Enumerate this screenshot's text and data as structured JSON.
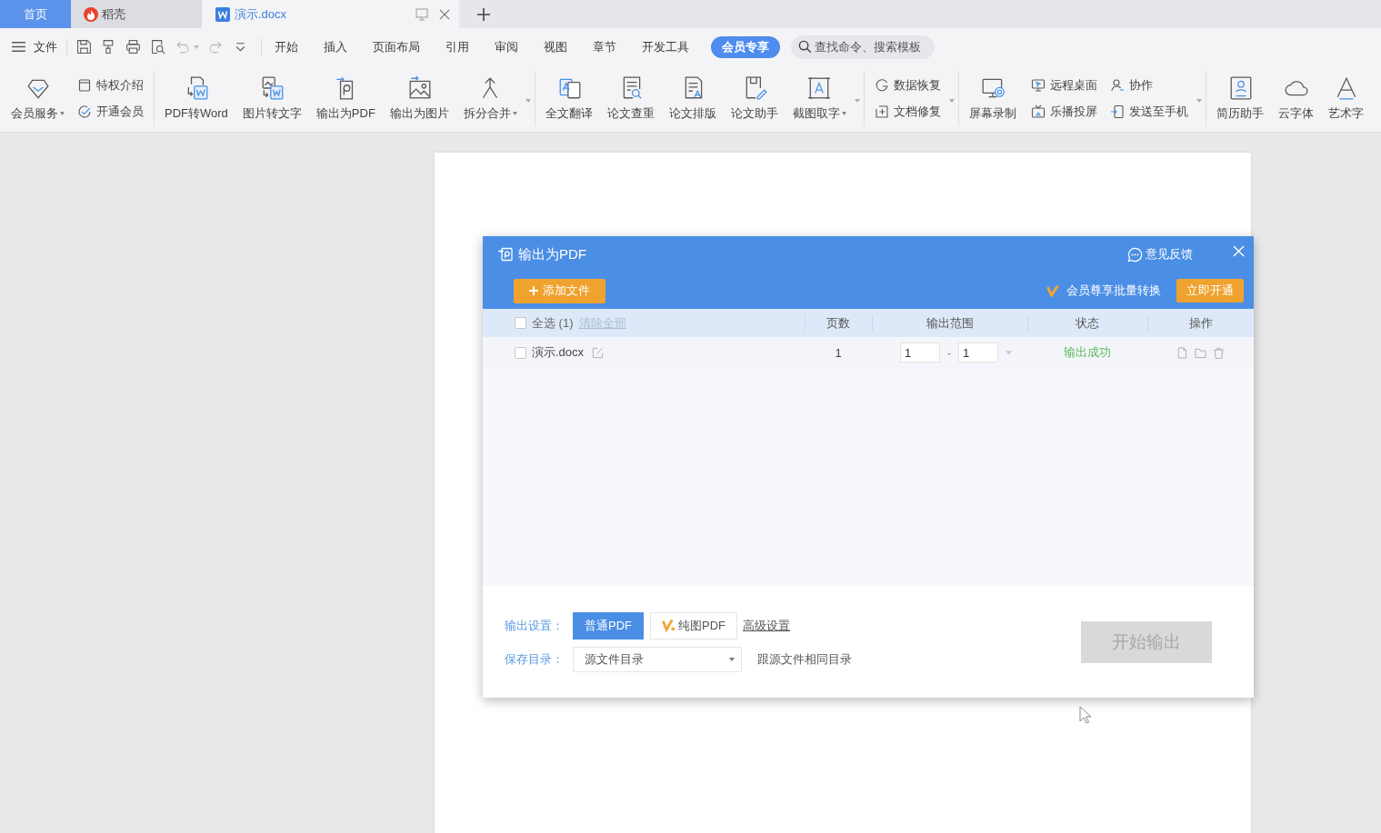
{
  "tabs": [
    {
      "kind": "home",
      "label": "首页",
      "selected": false
    },
    {
      "kind": "docer",
      "label": "稻壳",
      "selected": false
    },
    {
      "kind": "document",
      "label": "演示.docx",
      "selected": true
    }
  ],
  "menu": {
    "file": "文件",
    "items": [
      {
        "label": "开始",
        "selected": false
      },
      {
        "label": "插入",
        "selected": false
      },
      {
        "label": "页面布局",
        "selected": false
      },
      {
        "label": "引用",
        "selected": false
      },
      {
        "label": "审阅",
        "selected": false
      },
      {
        "label": "视图",
        "selected": false
      },
      {
        "label": "章节",
        "selected": false
      },
      {
        "label": "开发工具",
        "selected": false
      },
      {
        "label": "会员专享",
        "selected": true
      }
    ],
    "search": {
      "placeholder": "查找命令、搜索模板"
    }
  },
  "ribbon": {
    "groups": [
      {
        "items": [
          {
            "kind": "large",
            "label": "会员服务",
            "menu": true
          },
          {
            "kind": "column",
            "items": [
              {
                "label": "特权介绍"
              },
              {
                "label": "开通会员"
              }
            ]
          }
        ]
      },
      {
        "items": [
          {
            "kind": "large",
            "label": "PDF转Word",
            "menu": false
          },
          {
            "kind": "large",
            "label": "图片转文字",
            "menu": false
          },
          {
            "kind": "large",
            "label": "输出为PDF",
            "menu": false
          },
          {
            "kind": "large",
            "label": "输出为图片",
            "menu": false
          },
          {
            "kind": "large",
            "label": "拆分合并",
            "menu": true
          },
          {
            "kind": "more"
          }
        ]
      },
      {
        "items": [
          {
            "kind": "large",
            "label": "全文翻译",
            "menu": false
          },
          {
            "kind": "large",
            "label": "论文查重",
            "menu": false
          },
          {
            "kind": "large",
            "label": "论文排版",
            "menu": false
          },
          {
            "kind": "large",
            "label": "论文助手",
            "menu": false
          },
          {
            "kind": "large",
            "label": "截图取字",
            "menu": true
          },
          {
            "kind": "more"
          }
        ]
      },
      {
        "items": [
          {
            "kind": "column",
            "items": [
              {
                "label": "数据恢复"
              },
              {
                "label": "文档修复"
              }
            ]
          },
          {
            "kind": "more"
          }
        ]
      },
      {
        "items": [
          {
            "kind": "large",
            "label": "屏幕录制",
            "menu": false
          },
          {
            "kind": "column",
            "items": [
              {
                "label": "远程桌面"
              },
              {
                "label": "乐播投屏"
              }
            ]
          },
          {
            "kind": "column",
            "items": [
              {
                "label": "协作"
              },
              {
                "label": "发送至手机"
              }
            ]
          },
          {
            "kind": "more"
          }
        ]
      },
      {
        "items": [
          {
            "kind": "large",
            "label": "简历助手",
            "menu": false
          },
          {
            "kind": "large",
            "label": "云字体",
            "menu": false
          },
          {
            "kind": "large",
            "label": "艺术字",
            "menu": false
          }
        ]
      }
    ]
  },
  "dialog": {
    "title": "输出为PDF",
    "feedback": "意见反馈",
    "add_button": "添加文件",
    "promo": "会员尊享批量转换",
    "promo_button": "立即开通",
    "table": {
      "select_all": {
        "label": "全选 (1)",
        "checked": false
      },
      "clear": "清除全部",
      "columns": [
        "页数",
        "输出范围",
        "状态",
        "操作"
      ],
      "rows": [
        {
          "name": "演示.docx",
          "checked": false,
          "pages": "1",
          "from": "1",
          "separator": "-",
          "to": "1",
          "status": "输出成功"
        }
      ]
    },
    "settings": {
      "label": "输出设置：",
      "modes": [
        {
          "label": "普通PDF",
          "selected": true,
          "premium": false
        },
        {
          "label": "纯图PDF",
          "selected": false,
          "premium": true
        }
      ],
      "advanced": "高级设置"
    },
    "save": {
      "label": "保存目录：",
      "value": "源文件目录",
      "note": "跟源文件相同目录"
    },
    "start_button": {
      "label": "开始输出",
      "disabled": true
    }
  }
}
